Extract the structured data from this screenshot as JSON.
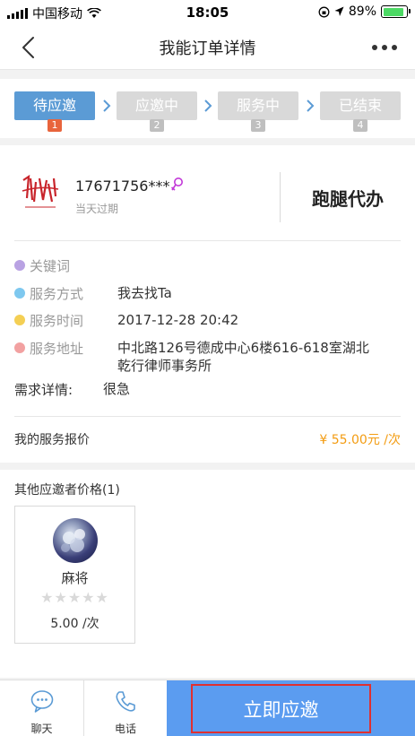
{
  "status_bar": {
    "carrier": "中国移动",
    "time": "18:05",
    "battery": "89%",
    "battery_level": 0.89
  },
  "nav": {
    "title": "我能订单详情"
  },
  "steps": [
    {
      "label": "待应邀",
      "num": "1",
      "active": true
    },
    {
      "label": "应邀中",
      "num": "2",
      "active": false
    },
    {
      "label": "服务中",
      "num": "3",
      "active": false
    },
    {
      "label": "已结束",
      "num": "4",
      "active": false
    }
  ],
  "order": {
    "phone": "17671756***",
    "expire": "当天过期",
    "service_type": "跑腿代办",
    "rows": [
      {
        "label": "关键词",
        "value": "",
        "icon": "purple-dot-icon",
        "color": "#b9a2e3"
      },
      {
        "label": "服务方式",
        "value": "我去找Ta",
        "icon": "blue-dot-icon",
        "color": "#7ec8ef"
      },
      {
        "label": "服务时间",
        "value": "2017-12-28 20:42",
        "icon": "yellow-dot-icon",
        "color": "#f4cf54"
      },
      {
        "label": "服务地址",
        "value": "中北路126号德成中心6楼616-618室湖北乾行律师事务所",
        "icon": "red-dot-icon",
        "color": "#f2a1a1"
      }
    ],
    "detail_label": "需求详情:",
    "detail_value": "很急",
    "quote_label": "我的服务报价",
    "quote_value": "¥ 55.00元 /次"
  },
  "others": {
    "title": "其他应邀者价格(1)",
    "bidders": [
      {
        "name": "麻将",
        "rating": 0,
        "price": "5.00 /次"
      }
    ]
  },
  "tabbar": {
    "chat": "聊天",
    "phone": "电话",
    "accept": "立即应邀"
  },
  "colors": {
    "accent": "#5b9bd5",
    "cta": "#5b9cf0",
    "price": "#f39c12",
    "step_active_num": "#e8643c"
  }
}
